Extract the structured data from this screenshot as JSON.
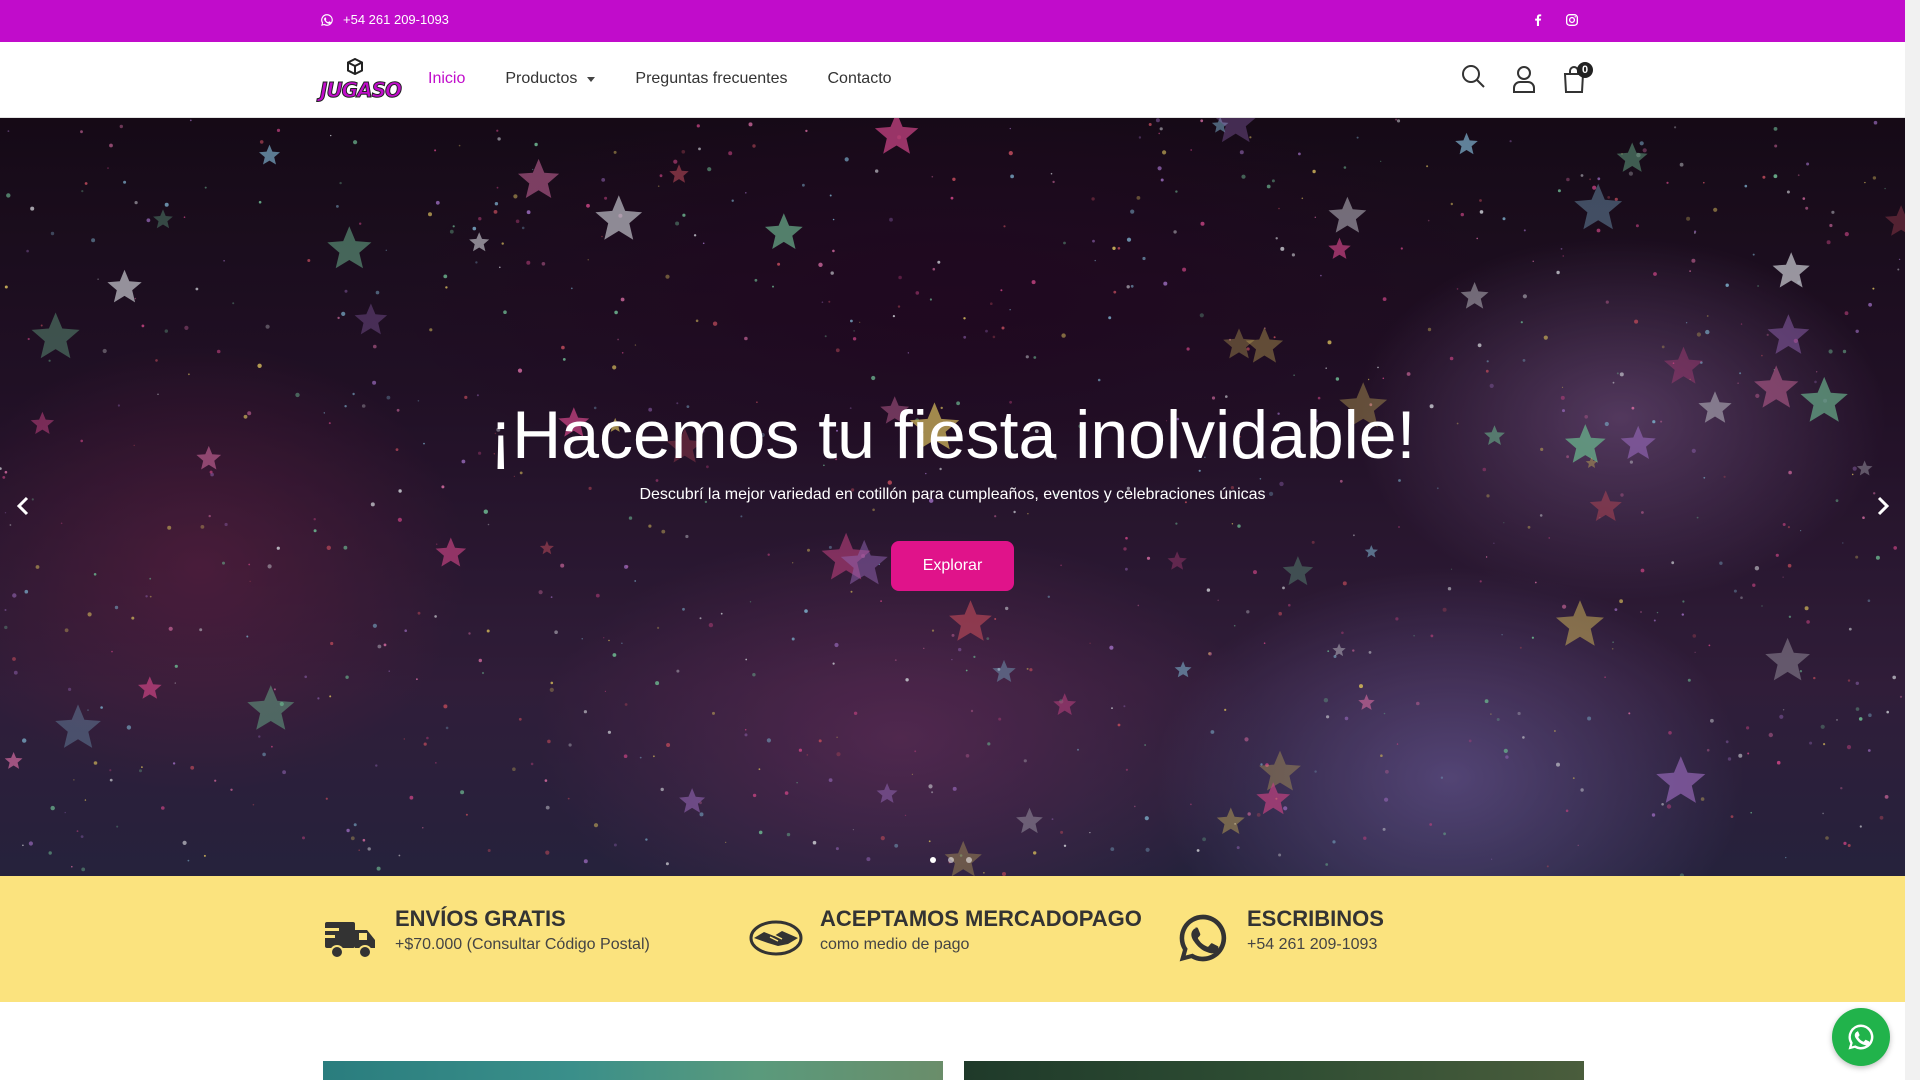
{
  "topbar": {
    "phone": "+54 261 209-1093",
    "social": [
      "facebook-icon",
      "instagram-icon"
    ],
    "bg_color": "#c10ccb"
  },
  "header": {
    "logo_text": "JUGASO",
    "nav": [
      {
        "label": "Inicio",
        "active": true
      },
      {
        "label": "Productos",
        "dropdown": true
      },
      {
        "label": "Preguntas frecuentes"
      },
      {
        "label": "Contacto"
      }
    ],
    "tools": [
      "search-icon",
      "user-icon",
      "bag-icon"
    ],
    "cart_count": "0"
  },
  "hero": {
    "title": "¡Hacemos tu fiesta inolvidable!",
    "subtitle": "Descubrí la mejor variedad en cotillón para cumpleaños, eventos y celebraciones únicas",
    "button": "Explorar",
    "button_color": "#e0138a",
    "slides": 3,
    "active_slide": 1
  },
  "features": [
    {
      "icon": "truck-icon",
      "title": "ENVÍOS GRATIS",
      "text": "+$70.000 (Consultar Código Postal)"
    },
    {
      "icon": "handshake-icon",
      "title": "ACEPTAMOS MERCADOPAGO",
      "text": "como medio de pago"
    },
    {
      "icon": "whatsapp-icon",
      "title": "ESCRIBINOS",
      "text": "+54 261 209-1093"
    }
  ],
  "features_bg": "#fbe37e",
  "whatsapp_button_color": "#21b34b"
}
